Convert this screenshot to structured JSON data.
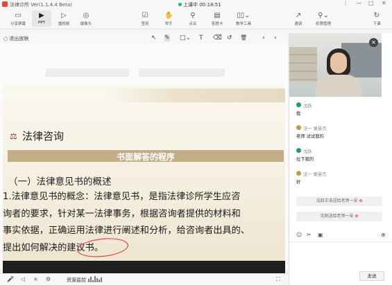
{
  "window": {
    "title": "法律诊所 Ver(1.1.4.4 Beta)",
    "live_status": "上课中 00:18:51",
    "controls": [
      "⋮",
      "—",
      "□",
      "✕"
    ]
  },
  "toolbar": {
    "left": [
      {
        "label": "分享屏幕",
        "icon": "screen-share-icon",
        "glyph": "▭"
      },
      {
        "label": "PPT",
        "icon": "ppt-icon",
        "glyph": "▶"
      },
      {
        "label": "播视频",
        "icon": "video-play-icon",
        "glyph": "▷"
      },
      {
        "label": "摄像头",
        "icon": "camera-icon",
        "glyph": "◎"
      }
    ],
    "center": [
      {
        "label": "签到",
        "icon": "checkin-icon",
        "glyph": "☑"
      },
      {
        "label": "举手",
        "icon": "hand-raise-icon",
        "glyph": "✋"
      },
      {
        "label": "点名",
        "icon": "rollcall-icon",
        "glyph": "⚲"
      },
      {
        "label": "答题卡",
        "icon": "answer-card-icon",
        "glyph": "▤"
      },
      {
        "label": "教学工具",
        "icon": "teaching-tools-icon",
        "glyph": "▯▯⌄"
      }
    ],
    "right": [
      {
        "label": "邀请",
        "icon": "invite-icon",
        "glyph": "↗"
      },
      {
        "label": "权限管理",
        "icon": "permission-icon",
        "glyph": "⚲⌄"
      },
      {
        "label": "下课",
        "icon": "end-class-icon",
        "glyph": "↻"
      }
    ]
  },
  "subbar": {
    "exit_label": "退出放映",
    "tools": [
      {
        "name": "pointer-tool",
        "glyph": "↖"
      },
      {
        "name": "pen-tool",
        "glyph": "✎"
      },
      {
        "name": "shape-tool",
        "glyph": "□⌄"
      },
      {
        "name": "text-tool",
        "glyph": "T"
      },
      {
        "name": "eraser-tool",
        "glyph": "⌫"
      },
      {
        "name": "undo-tool",
        "glyph": "↺"
      },
      {
        "name": "clear-tool",
        "glyph": "🗑"
      },
      {
        "name": "prev-page",
        "glyph": "‹"
      },
      {
        "name": "next-page",
        "glyph": "›"
      }
    ]
  },
  "slide": {
    "title": "法律咨询",
    "band": "书面解答的程序",
    "section": "（一）法律意见书的概述",
    "lines": [
      "1.法律意见书的概念：法律意见书，是指法律诊所学生应咨",
      "询者的要求，针对某一法律事务，根据咨询者提供的材料和",
      "事实依据，正确运用法律进行阐述和分析，给咨询者出具的、",
      "提出如何解决的建议书。"
    ]
  },
  "bottombar": {
    "icons": [
      "mic-icon",
      "speaker-icon",
      "mute-icon",
      "settings-icon"
    ],
    "monitor_label": "资源监控",
    "fullscreen_glyph": "⛶"
  },
  "chat": {
    "messages": [
      {
        "name": "沈跃",
        "text": "我",
        "avatar": "green"
      },
      {
        "name": "法一 栗慧杰",
        "text": "老师 试试我的",
        "avatar": "gold"
      },
      {
        "name": "沈跃",
        "text": "拉下我的",
        "avatar": "green"
      },
      {
        "name": "法一 栗慧杰",
        "text": "好",
        "avatar": "gold"
      }
    ],
    "gifts": [
      "法四王浩送给老师一朵",
      "沈跃送给老师一朵"
    ],
    "tools": [
      "emoji-icon",
      "scissors-icon",
      "image-icon",
      "add-icon"
    ],
    "send_label": "发送"
  },
  "colors": {
    "accent_red": "#d2252c",
    "band": "#c3ad86",
    "online_green": "#2bb673"
  }
}
